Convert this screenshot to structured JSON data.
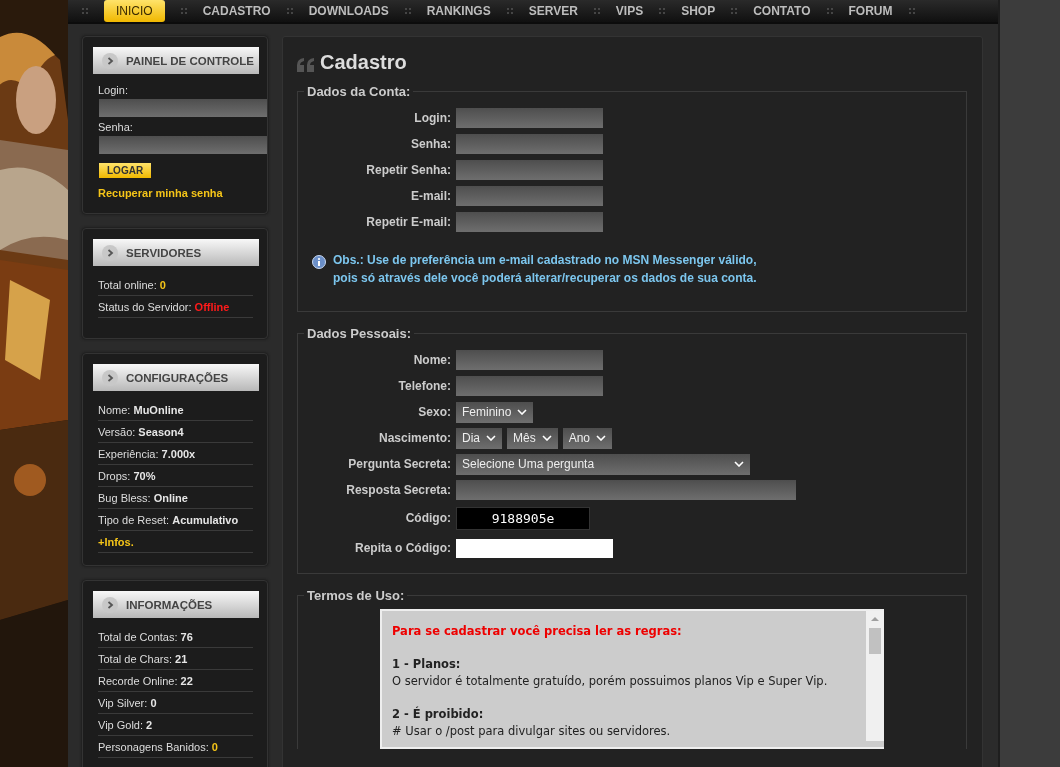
{
  "nav": [
    {
      "label": "INICIO",
      "selected": true
    },
    {
      "label": "CADASTRO",
      "selected": false
    },
    {
      "label": "DOWNLOADS",
      "selected": false
    },
    {
      "label": "RANKINGS",
      "selected": false
    },
    {
      "label": "SERVER",
      "selected": false
    },
    {
      "label": "VIPS",
      "selected": false
    },
    {
      "label": "SHOP",
      "selected": false
    },
    {
      "label": "CONTATO",
      "selected": false
    },
    {
      "label": "FORUM",
      "selected": false
    }
  ],
  "sidebar": [
    {
      "title": "PAINEL DE CONTROLE",
      "kind": "login",
      "fields": [
        {
          "label": "Login:"
        },
        {
          "label": "Senha:"
        }
      ],
      "button": "LOGAR",
      "link": "Recuperar minha senha"
    },
    {
      "title": "SERVIDORES",
      "kind": "stats",
      "rows": [
        {
          "label": "Total online:",
          "value": "0",
          "color": "#f5c518"
        },
        {
          "label": "Status do Servidor:",
          "value": "Offline",
          "color": "#ff1a1a"
        }
      ]
    },
    {
      "title": "CONFIGURAÇÕES",
      "kind": "stats",
      "rows": [
        {
          "label": "Nome:",
          "value": "MuOnline",
          "color": "#e6e6e6"
        },
        {
          "label": "Versão:",
          "value": "Season4",
          "color": "#e6e6e6"
        },
        {
          "label": "Experiência:",
          "value": "7.000x",
          "color": "#e6e6e6"
        },
        {
          "label": "Drops:",
          "value": "70%",
          "color": "#e6e6e6"
        },
        {
          "label": "Bug Bless:",
          "value": "Online",
          "color": "#e6e6e6"
        },
        {
          "label": "Tipo de Reset:",
          "value": "Acumulativo",
          "color": "#e6e6e6"
        }
      ],
      "link": "+Infos."
    },
    {
      "title": "INFORMAÇÕES",
      "kind": "stats",
      "rows": [
        {
          "label": "Total de Contas:",
          "value": "76",
          "color": "#e6e6e6"
        },
        {
          "label": "Total de Chars:",
          "value": "21",
          "color": "#e6e6e6"
        },
        {
          "label": "Recorde Online:",
          "value": "22",
          "color": "#e6e6e6"
        },
        {
          "label": "Vip Silver:",
          "value": "0",
          "color": "#e6e6e6"
        },
        {
          "label": "Vip Gold:",
          "value": "2",
          "color": "#e6e6e6"
        },
        {
          "label": "Personagens Banidos:",
          "value": "0",
          "color": "#f5c518"
        }
      ]
    }
  ],
  "page": {
    "title": "Cadastro",
    "sections": [
      {
        "legend": "Dados da Conta:",
        "kind": "form",
        "rows": [
          {
            "label": "Login:",
            "kind": "input"
          },
          {
            "label": "Senha:",
            "kind": "input"
          },
          {
            "label": "Repetir Senha:",
            "kind": "input"
          },
          {
            "label": "E-mail:",
            "kind": "input"
          },
          {
            "label": "Repetir E-mail:",
            "kind": "input"
          }
        ],
        "note": [
          "Obs.: Use de preferência um e-mail cadastrado no MSN Messenger válido,",
          "pois só através dele você poderá alterar/recuperar os dados de sua conta."
        ]
      },
      {
        "legend": "Dados Pessoais:",
        "kind": "form",
        "rows": [
          {
            "label": "Nome:",
            "kind": "input"
          },
          {
            "label": "Telefone:",
            "kind": "input"
          },
          {
            "label": "Sexo:",
            "kind": "select",
            "choices": [
              "Feminino"
            ]
          },
          {
            "label": "Nascimento:",
            "kind": "select",
            "choices": [
              "Dia",
              "Mês",
              "Ano"
            ]
          },
          {
            "label": "Pergunta Secreta:",
            "kind": "wide_select",
            "choices": [
              "Selecione Uma pergunta"
            ]
          },
          {
            "label": "Resposta Secreta:",
            "kind": "wide_input"
          },
          {
            "label": "Código:",
            "kind": "captcha",
            "value": "9188905e"
          },
          {
            "label": "Repita o Código:",
            "kind": "code_input"
          }
        ]
      },
      {
        "legend": "Termos de Uso:",
        "kind": "terms",
        "lines": [
          {
            "text": "Para se cadastrar você precisa ler as regras:",
            "kind": "alert"
          },
          {
            "text": "1 - Planos:",
            "kind": "heading"
          },
          {
            "text": "O servidor é totalmente gratuído, porém possuimos planos Vip e Super Vip.",
            "kind": "text"
          },
          {
            "text": "2 - É proibido:",
            "kind": "heading"
          },
          {
            "text": "# Usar o /post para divulgar sites ou servidores.",
            "kind": "text"
          }
        ]
      }
    ]
  }
}
